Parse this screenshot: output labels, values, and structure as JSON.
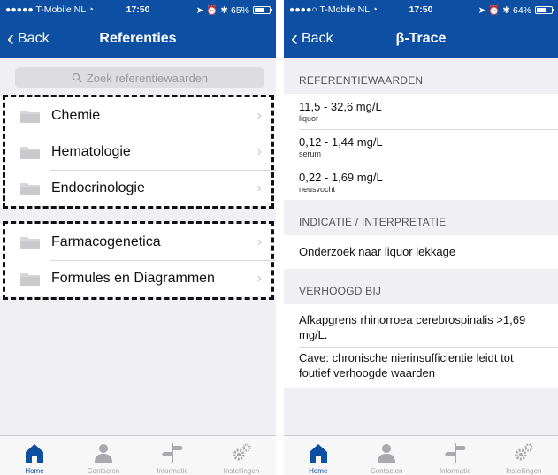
{
  "left": {
    "status": {
      "carrier": "●●●●● T-Mobile NL ◔",
      "time": "17:50",
      "right": "➤ ⏰ ✱ 65%",
      "battery_level": 0.65
    },
    "nav": {
      "back_label": "Back",
      "title": "Referenties"
    },
    "search": {
      "placeholder": "Zoek referentiewaarden"
    },
    "group_a": [
      {
        "label": "Chemie"
      },
      {
        "label": "Hematologie"
      },
      {
        "label": "Endocrinologie"
      }
    ],
    "group_b": [
      {
        "label": "Farmacogenetica"
      },
      {
        "label": "Formules en Diagrammen"
      }
    ]
  },
  "right": {
    "status": {
      "carrier": "●●●●○ T-Mobile NL ◔",
      "time": "17:50",
      "right": "➤ ⏰ ✱ 64%",
      "battery_level": 0.64
    },
    "nav": {
      "back_label": "Back",
      "title": "β-Trace"
    },
    "sections": [
      {
        "header": "REFERENTIEWAARDEN",
        "cells": [
          {
            "value": "11,5 - 32,6 mg/L",
            "sub": "liquor"
          },
          {
            "value": "0,12 - 1,44 mg/L",
            "sub": "serum"
          },
          {
            "value": "0,22 - 1,69 mg/L",
            "sub": "neusvocht"
          }
        ]
      },
      {
        "header": "INDICATIE / INTERPRETATIE",
        "cells": [
          {
            "text": "Onderzoek naar liquor lekkage"
          }
        ]
      },
      {
        "header": "VERHOOGD BIJ",
        "cells": [
          {
            "text": "Afkapgrens rhinorroea cerebrospinalis >1,69 mg/L."
          },
          {
            "text": "Cave: chronische nierinsufficientie leidt tot foutief verhoogde waarden"
          }
        ]
      }
    ]
  },
  "tabs": [
    {
      "label": "Home",
      "icon": "home-icon"
    },
    {
      "label": "Contacten",
      "icon": "person-icon"
    },
    {
      "label": "Informatie",
      "icon": "signpost-icon"
    },
    {
      "label": "Instellingen",
      "icon": "gears-icon"
    }
  ],
  "colors": {
    "brand": "#0d4fa3",
    "background": "#efeff4",
    "tab_inactive": "#a8a8ad"
  }
}
